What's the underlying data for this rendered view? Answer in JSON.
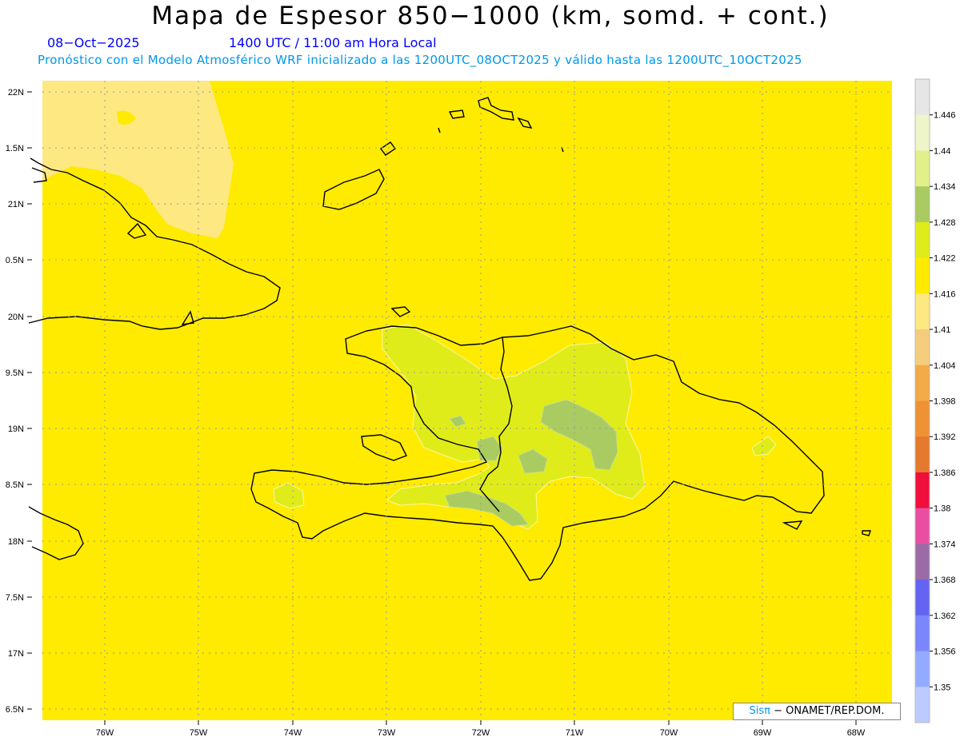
{
  "header": {
    "title": "Mapa de Espesor 850−1000 (km, somd. + cont.)",
    "date": "08−Oct−2025",
    "time": "1400 UTC / 11:00 am Hora Local",
    "subtitle": "Pronóstico con el Modelo Atmosférico WRF inicializado a las 1200UTC_08OCT2025 y válido hasta las  1200UTC_10OCT2025"
  },
  "map": {
    "lat_labels": [
      "22N",
      "1.5N",
      "21N",
      "0.5N",
      "20N",
      "9.5N",
      "19N",
      "8.5N",
      "18N",
      "7.5N",
      "17N",
      "6.5N"
    ],
    "lon_labels": [
      "76W",
      "75W",
      "74W",
      "73W",
      "72W",
      "71W",
      "70W",
      "69W",
      "68W"
    ],
    "background_color": "#ffeb00"
  },
  "legend": {
    "labels": [
      "1.446",
      "1.44",
      "1.434",
      "1.428",
      "1.422",
      "1.416",
      "1.41",
      "1.404",
      "1.398",
      "1.392",
      "1.386",
      "1.38",
      "1.374",
      "1.368",
      "1.362",
      "1.356",
      "1.35"
    ],
    "colors": [
      "#e6e6e6",
      "#eef5c8",
      "#e2f08a",
      "#a9cb62",
      "#e0ec1a",
      "#ffeb00",
      "#fde882",
      "#f4cd7c",
      "#f2aa48",
      "#ee9235",
      "#e57a2e",
      "#ef0e3c",
      "#e94fa1",
      "#9a6ba5",
      "#6464f2",
      "#7b86fd",
      "#93abff",
      "#bccbff"
    ]
  },
  "credit": {
    "sis": "Sisπ",
    "text": "− ONAMET/REP.DOM."
  }
}
